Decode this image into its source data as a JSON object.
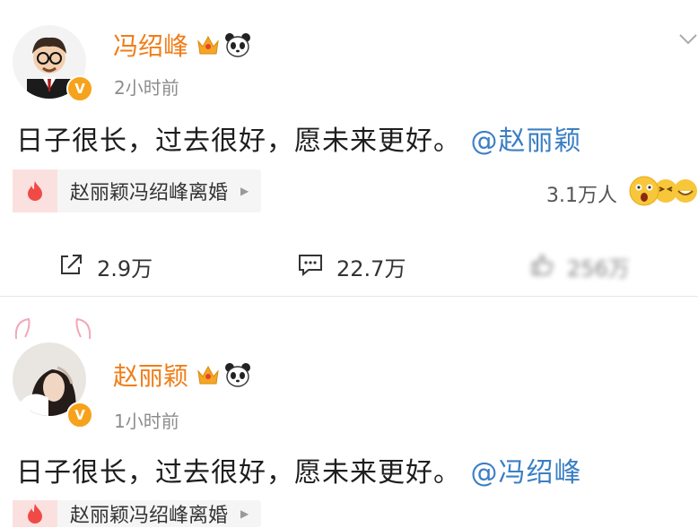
{
  "post1": {
    "author": "冯绍峰",
    "time": "2小时前",
    "content_text": "日子很长，过去很好，愿未来更好。",
    "mention": "@赵丽颖",
    "topic": "赵丽颖冯绍峰离婚",
    "heat": "3.1万人",
    "shares": "2.9万",
    "comments": "22.7万",
    "likes": "256万"
  },
  "post2": {
    "author": "赵丽颖",
    "time": "1小时前",
    "content_text": "日子很长，过去很好，愿未来更好。",
    "mention": "@冯绍峰",
    "topic": "赵丽颖冯绍峰离婚"
  },
  "icons": {
    "verified": "vip-verified-icon",
    "crown": "crown-icon",
    "panda": "panda-icon",
    "share": "share-icon",
    "comment": "comment-icon",
    "like": "like-icon",
    "topic": "flame-icon",
    "more": "chevron-down-icon"
  },
  "colors": {
    "name": "#f07d19",
    "mention": "#3b7fc4",
    "badge": "#f7a21b",
    "topic_icon": "#f04a47"
  }
}
